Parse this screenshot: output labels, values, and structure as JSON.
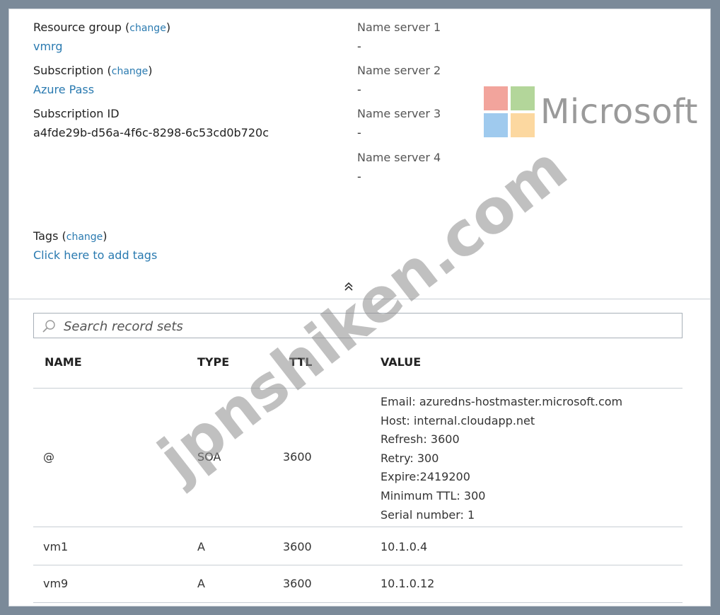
{
  "essentials": {
    "resource_group": {
      "label": "Resource group",
      "change": "change",
      "value": "vmrg"
    },
    "subscription": {
      "label": "Subscription",
      "change": "change",
      "value": "Azure Pass"
    },
    "subscription_id": {
      "label": "Subscription ID",
      "value": "a4fde29b-d56a-4f6c-8298-6c53cd0b720c"
    },
    "tags": {
      "label": "Tags",
      "change": "change",
      "value": "Click here to add tags"
    },
    "name_servers": [
      {
        "label": "Name server 1",
        "value": "-"
      },
      {
        "label": "Name server 2",
        "value": "-"
      },
      {
        "label": "Name server 3",
        "value": "-"
      },
      {
        "label": "Name server 4",
        "value": "-"
      }
    ]
  },
  "search": {
    "placeholder": "Search record sets",
    "icon": "search-icon"
  },
  "table": {
    "columns": [
      "NAME",
      "TYPE",
      "TTL",
      "VALUE"
    ],
    "rows": [
      {
        "name": "@",
        "type": "SOA",
        "ttl": "3600",
        "value_lines": [
          "Email: azuredns-hostmaster.microsoft.com",
          "Host: internal.cloudapp.net",
          "Refresh: 3600",
          "Retry: 300",
          "Expire:2419200",
          "Minimum TTL: 300",
          "Serial number: 1"
        ]
      },
      {
        "name": "vm1",
        "type": "A",
        "ttl": "3600",
        "value": "10.1.0.4"
      },
      {
        "name": "vm9",
        "type": "A",
        "ttl": "3600",
        "value": "10.1.0.12"
      }
    ]
  },
  "logo": {
    "text": "Microsoft",
    "colors": [
      "#f25022",
      "#7fba00",
      "#00a4ef",
      "#ffb900"
    ]
  },
  "watermark": {
    "text": "jpnshiken.com"
  },
  "colors": {
    "link": "#2a7ab0",
    "background": "#7b8a99"
  }
}
